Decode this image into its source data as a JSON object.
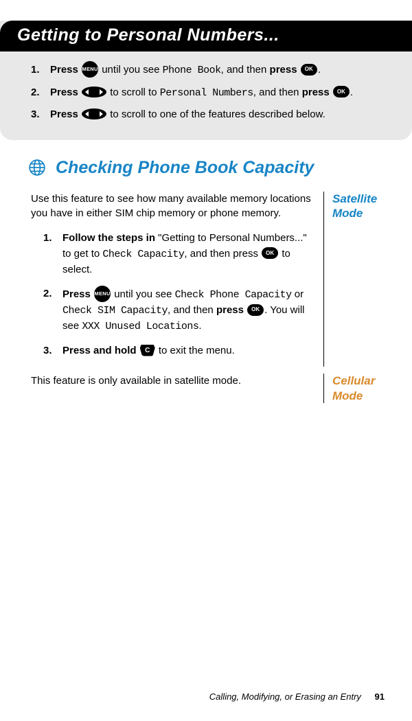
{
  "header": {
    "title": "Getting to Personal Numbers..."
  },
  "top_steps": [
    {
      "n": "1.",
      "bold1": "Press ",
      "icon1": "menu",
      "mid": " until you see ",
      "mono1": "Phone Book",
      "mid2": ", and then ",
      "bold2": "press ",
      "icon2": "ok",
      "tail": "."
    },
    {
      "n": "2.",
      "bold1": "Press ",
      "icon1": "nav",
      "mid": " to scroll to ",
      "mono1": "Personal Numbers",
      "mid2": ", and then ",
      "bold2": "press ",
      "icon2": "ok",
      "tail": "."
    },
    {
      "n": "3.",
      "bold1": "Press ",
      "icon1": "nav",
      "mid": " to scroll to one of the features described below.",
      "mono1": "",
      "mid2": "",
      "bold2": "",
      "icon2": "",
      "tail": ""
    }
  ],
  "section": {
    "heading": "Checking Phone Book Capacity",
    "intro": "Use this feature to see how many available memory locations you have in either SIM chip memory or phone memory.",
    "steps": [
      {
        "n": "1.",
        "bold1": "Follow the steps in",
        "t1": " \"Getting to Personal Numbers...\" to get to ",
        "mono1": "Check Capacity",
        "t2": ", and then press ",
        "icon1": "ok",
        "t3": " to select."
      },
      {
        "n": "2.",
        "bold1": "Press ",
        "icon_pre": "menu",
        "t1": " until you see ",
        "mono1": "Check Phone Capacity",
        "t_or": " or ",
        "mono2": "Check SIM Capacity",
        "t2": ", and then ",
        "bold2": "press ",
        "icon1": "ok",
        "t3": ". You will see ",
        "mono3": "XXX Unused Locations",
        "t4": "."
      },
      {
        "n": "3.",
        "bold1": "Press and hold ",
        "icon_pre": "c",
        "t1": " to exit the menu."
      }
    ],
    "note": "This feature is only available in satellite mode."
  },
  "modes": {
    "sat": "Satellite Mode",
    "cell": "Cellular Mode"
  },
  "footer": {
    "text": "Calling, Modifying, or Erasing an Entry",
    "page": "91"
  }
}
